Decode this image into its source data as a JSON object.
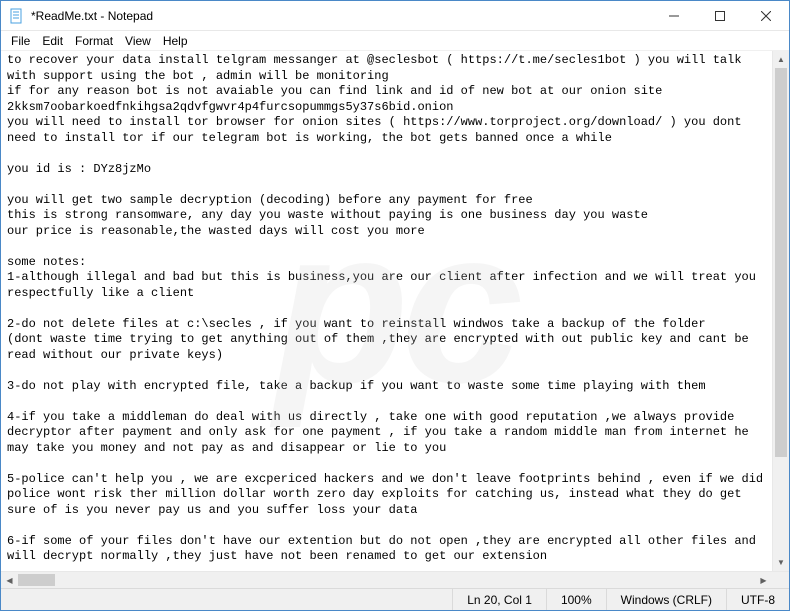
{
  "window": {
    "title": "*ReadMe.txt - Notepad"
  },
  "menu": {
    "file": "File",
    "edit": "Edit",
    "format": "Format",
    "view": "View",
    "help": "Help"
  },
  "content": "to recover your data install telgram messanger at @seclesbot ( https://t.me/secles1bot ) you will talk with support using the bot , admin will be monitoring\nif for any reason bot is not avaiable you can find link and id of new bot at our onion site 2kksm7oobarkoedfnkihgsa2qdvfgwvr4p4furcsopummgs5y37s6bid.onion\nyou will need to install tor browser for onion sites ( https://www.torproject.org/download/ ) you dont need to install tor if our telegram bot is working, the bot gets banned once a while\n\nyou id is : DYz8jzMo\n\nyou will get two sample decryption (decoding) before any payment for free\nthis is strong ransomware, any day you waste without paying is one business day you waste\nour price is reasonable,the wasted days will cost you more\n\nsome notes:\n1-although illegal and bad but this is business,you are our client after infection and we will treat you respectfully like a client\n\n2-do not delete files at c:\\secles , if you want to reinstall windwos take a backup of the folder\n(dont waste time trying to get anything out of them ,they are encrypted with out public key and cant be read without our private keys)\n\n3-do not play with encrypted file, take a backup if you want to waste some time playing with them\n\n4-if you take a middleman do deal with us directly , take one with good reputation ,we always provide decryptor after payment and only ask for one payment , if you take a random middle man from internet he may take you money and not pay as and disappear or lie to you\n\n5-police can't help you , we are excpericed hackers and we don't leave footprints behind , even if we did police wont risk ther million dollar worth zero day exploits for catching us, instead what they do get sure of is you never pay us and you suffer loss your data\n\n6-if some of your files don't have our extention but do not open ,they are encrypted all other files and will decrypt normally ,they just have not been renamed to get our extension",
  "status": {
    "position": "Ln 20, Col 1",
    "zoom": "100%",
    "line_ending": "Windows (CRLF)",
    "encoding": "UTF-8"
  },
  "watermark": "pc"
}
